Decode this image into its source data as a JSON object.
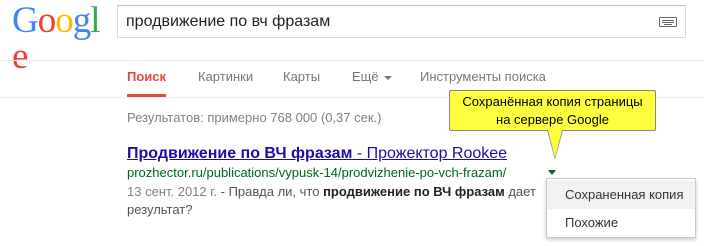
{
  "logo": {
    "letters": [
      "G",
      "o",
      "o",
      "g",
      "l",
      "e"
    ],
    "colors": [
      "#4285f4",
      "#ea4335",
      "#fbbc05",
      "#4285f4",
      "#34a853",
      "#ea4335"
    ]
  },
  "search": {
    "query": "продвижение по вч фразам",
    "icon": "keyboard-icon"
  },
  "tabs": [
    {
      "label": "Поиск",
      "active": true
    },
    {
      "label": "Картинки"
    },
    {
      "label": "Карты"
    },
    {
      "label": "Ещё",
      "has_dropdown": true
    },
    {
      "label": "Инструменты поиска"
    }
  ],
  "results_stats": "Результатов: примерно 768 000 (0,37 сек.)",
  "result": {
    "title_bold": "Продвижение по ВЧ фразам",
    "title_rest": " - Прожектор Rookee",
    "url": "prozhector.ru/publications/vypusk-14/prodvizhenie-po-vch-frazam/",
    "snippet_date": "13 сент. 2012 г.",
    "snippet_pre": " - Правда ли, что ",
    "snippet_bold": "продвижение по ВЧ фразам",
    "snippet_post": " дает результат?"
  },
  "dropdown": {
    "items": [
      "Сохраненная копия",
      "Похожие"
    ]
  },
  "tooltip": {
    "line1": "Сохранённая копия страницы",
    "line2": "на сервере Google"
  },
  "colors": {
    "accent": "#dd4b39",
    "link": "#1a0dab",
    "url": "#006621",
    "tooltip_bg": "#ffff40"
  }
}
